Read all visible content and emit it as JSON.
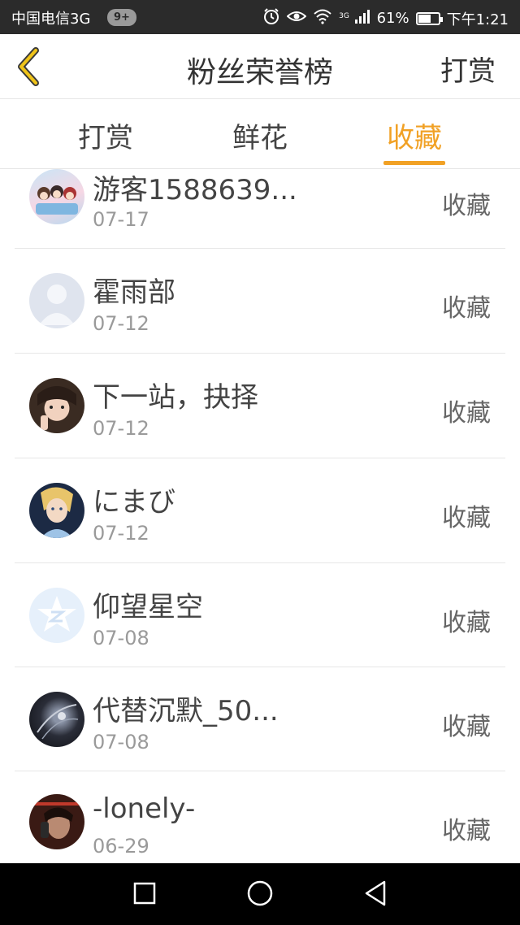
{
  "status_bar": {
    "carrier": "中国电信3G",
    "badge": "9+",
    "network": "3G",
    "battery": "61%",
    "battery_level": 0.61,
    "time": "下午1:21",
    "icons": [
      "alarm-icon",
      "eye-icon",
      "wifi-icon",
      "signal-icon",
      "battery-icon"
    ]
  },
  "header": {
    "title": "粉丝荣誉榜",
    "right_action": "打赏",
    "back_icon": "chevron-left-icon"
  },
  "tabs": [
    {
      "label": "打赏",
      "active": false
    },
    {
      "label": "鲜花",
      "active": false
    },
    {
      "label": "收藏",
      "active": true
    }
  ],
  "accent_color": "#f1a125",
  "list": [
    {
      "name": "游客1588639...",
      "date": "07-17",
      "action": "收藏",
      "avatar": "cartoon-girls-avatar"
    },
    {
      "name": "霍雨部",
      "date": "07-12",
      "action": "收藏",
      "avatar": "default-user-avatar"
    },
    {
      "name": "下一站，抉择",
      "date": "07-12",
      "action": "收藏",
      "avatar": "girl-photo-avatar"
    },
    {
      "name": "にまび",
      "date": "07-12",
      "action": "收藏",
      "avatar": "cinderella-avatar"
    },
    {
      "name": "仰望星空",
      "date": "07-08",
      "action": "收藏",
      "avatar": "qq-zone-avatar"
    },
    {
      "name": "代替沉默_50...",
      "date": "07-08",
      "action": "收藏",
      "avatar": "dark-abstract-avatar"
    },
    {
      "name": "-lonely-",
      "date": "06-29",
      "action": "收藏",
      "avatar": "phone-call-avatar"
    }
  ],
  "system_nav": {
    "icons": [
      "square-recent-icon",
      "circle-home-icon",
      "triangle-back-icon"
    ]
  }
}
